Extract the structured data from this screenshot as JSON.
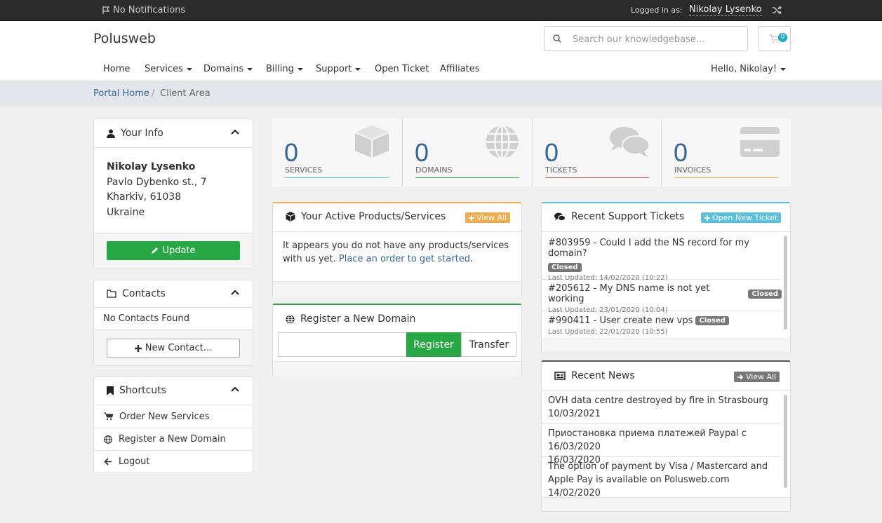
{
  "topbar": {
    "notifications": "No Notifications",
    "logged_in_label": "Logged in as:",
    "user_name": "Nikolay Lysenko"
  },
  "header": {
    "brand": "Polusweb",
    "search_placeholder": "Search our knowledgebase...",
    "cart_count": "0",
    "greeting": "Hello, Nikolay!"
  },
  "nav": [
    "Home",
    "Services",
    "Domains",
    "Billing",
    "Support",
    "Open Ticket",
    "Affiliates"
  ],
  "breadcrumb": {
    "home": "Portal Home",
    "sep": "/",
    "current": "Client Area"
  },
  "your_info": {
    "title": "Your Info",
    "name": "Nikolay Lysenko",
    "address1": "Pavlo Dybenko st., 7",
    "address2": "Kharkiv, 61038",
    "country": "Ukraine",
    "update_label": "Update"
  },
  "contacts": {
    "title": "Contacts",
    "empty": "No Contacts Found",
    "new_label": "New Contact..."
  },
  "shortcuts": {
    "title": "Shortcuts",
    "items": [
      "Order New Services",
      "Register a New Domain",
      "Logout"
    ]
  },
  "stats": [
    {
      "value": "0",
      "label": "SERVICES",
      "color": "#5bc0de"
    },
    {
      "value": "0",
      "label": "DOMAINS",
      "color": "#28a745"
    },
    {
      "value": "0",
      "label": "TICKETS",
      "color": "#d9534f"
    },
    {
      "value": "0",
      "label": "INVOICES",
      "color": "#f0ad4e"
    }
  ],
  "products": {
    "title": "Your Active Products/Services",
    "view_all": "View All",
    "text": "It appears you do not have any products/services with us yet.",
    "link": "Place an order to get started",
    "period": "."
  },
  "register_domain": {
    "title": "Register a New Domain",
    "register": "Register",
    "transfer": "Transfer"
  },
  "tickets": {
    "title": "Recent Support Tickets",
    "open_new": "Open New Ticket",
    "items": [
      {
        "subject": "#803959 - Could I add the NS record for my domain?",
        "status": "Closed",
        "updated": "Last Updated: 14/02/2020 (10:22)"
      },
      {
        "subject": "#205612 - My DNS name is not yet working",
        "status": "Closed",
        "updated": "Last Updated: 23/01/2020 (10:04)"
      },
      {
        "subject": "#990411 - User create new vps",
        "status": "Closed",
        "updated": "Last Updated: 22/01/2020 (10:55)"
      }
    ]
  },
  "news": {
    "title": "Recent News",
    "view_all": "View All",
    "items": [
      {
        "title": "OVH data centre destroyed by fire in Strasbourg",
        "date": "10/03/2021"
      },
      {
        "title": "Приостановка приема платежей Paypal с 16/03/2020",
        "date": "16/03/2020"
      },
      {
        "title": "The option of payment by Visa / Mastercard and Apple Pay is available on Polusweb.com",
        "date": "14/02/2020"
      }
    ]
  }
}
